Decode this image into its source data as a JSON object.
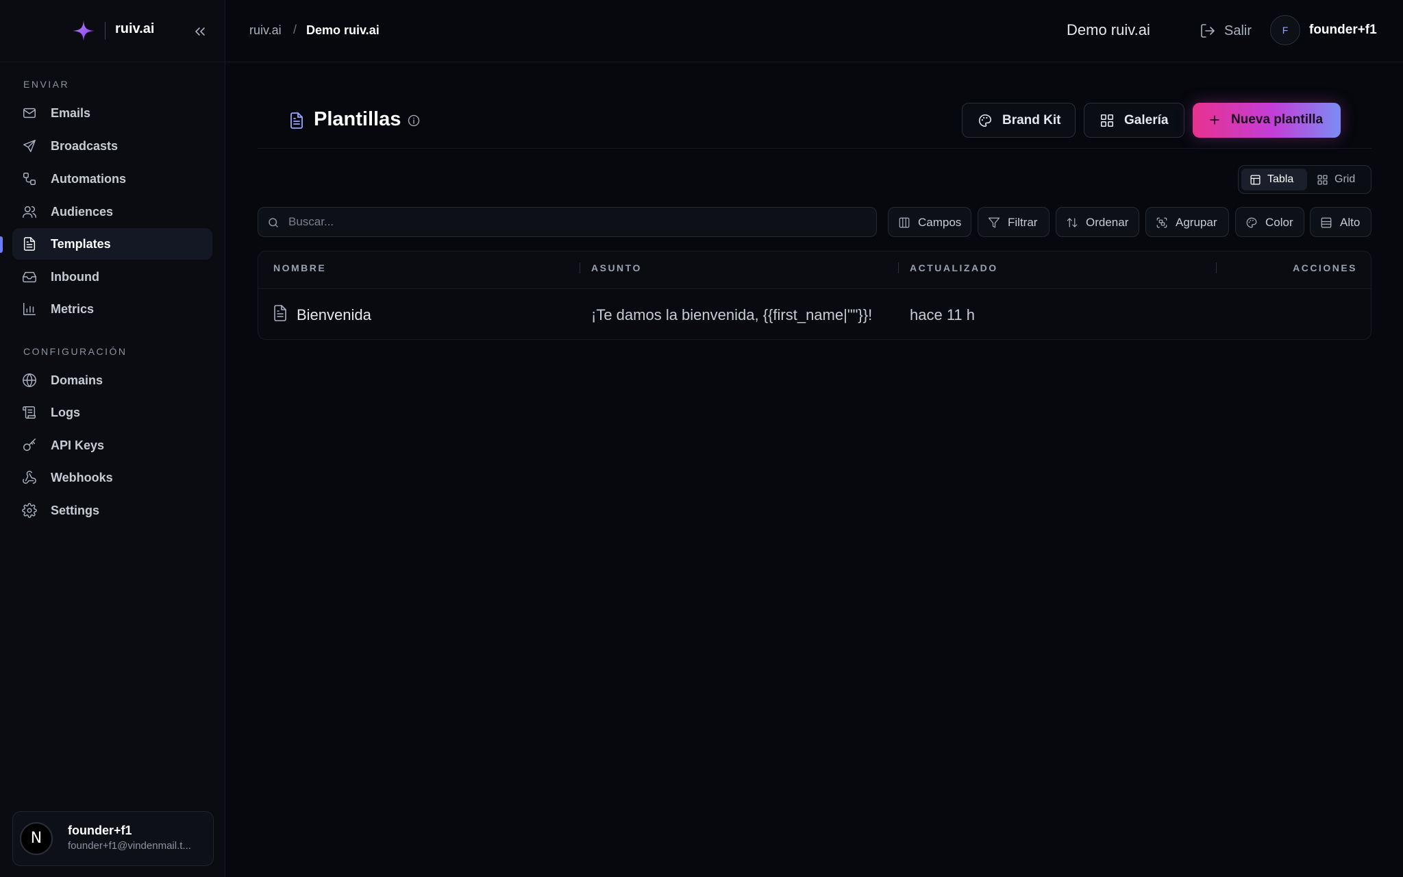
{
  "app": {
    "brand": "ruiv.ai"
  },
  "sidebar": {
    "sections": [
      {
        "label": "ENVIAR"
      },
      {
        "label": "CONFIGURACIÓN"
      }
    ],
    "items": [
      {
        "label": "Emails",
        "icon": "mail-icon"
      },
      {
        "label": "Broadcasts",
        "icon": "send-icon"
      },
      {
        "label": "Automations",
        "icon": "workflow-icon"
      },
      {
        "label": "Audiences",
        "icon": "users-icon"
      },
      {
        "label": "Templates",
        "icon": "file-text-icon",
        "active": true
      },
      {
        "label": "Inbound",
        "icon": "inbox-icon"
      },
      {
        "label": "Metrics",
        "icon": "bar-chart-icon"
      },
      {
        "label": "Domains",
        "icon": "globe-icon"
      },
      {
        "label": "Logs",
        "icon": "scroll-icon"
      },
      {
        "label": "API Keys",
        "icon": "key-icon"
      },
      {
        "label": "Webhooks",
        "icon": "webhook-icon"
      },
      {
        "label": "Settings",
        "icon": "gear-icon"
      }
    ],
    "user": {
      "avatar_letter": "N",
      "name": "founder+f1",
      "email": "founder+f1@vindenmail.t..."
    }
  },
  "topbar": {
    "breadcrumb": {
      "root": "ruiv.ai",
      "separator": "/",
      "current": "Demo ruiv.ai"
    },
    "org_name": "Demo ruiv.ai",
    "logout_label": "Salir",
    "avatar_letter": "F",
    "user_name": "founder+f1"
  },
  "page": {
    "title": "Plantillas",
    "buttons": {
      "brand_kit": "Brand Kit",
      "gallery": "Galería",
      "new_template": "Nueva plantilla"
    },
    "view_toggle": {
      "table": "Tabla",
      "grid": "Grid",
      "selected": "Tabla"
    },
    "search": {
      "placeholder": "Buscar...",
      "value": ""
    },
    "filters": {
      "fields": "Campos",
      "filter": "Filtrar",
      "sort": "Ordenar",
      "group": "Agrupar",
      "color": "Color",
      "height": "Alto"
    }
  },
  "table": {
    "columns": {
      "name": "NOMBRE",
      "subject": "ASUNTO",
      "updated": "ACTUALIZADO",
      "actions": "ACCIONES"
    },
    "rows": [
      {
        "name": "Bienvenida",
        "subject": "¡Te damos la bienvenida, {{first_name|\"\"}}!",
        "updated": "hace 11 h"
      }
    ]
  },
  "colors": {
    "accent": "#6e7bff",
    "gradient_start": "#e8318f",
    "gradient_end": "#7b8cf5",
    "background": "#06080d"
  }
}
